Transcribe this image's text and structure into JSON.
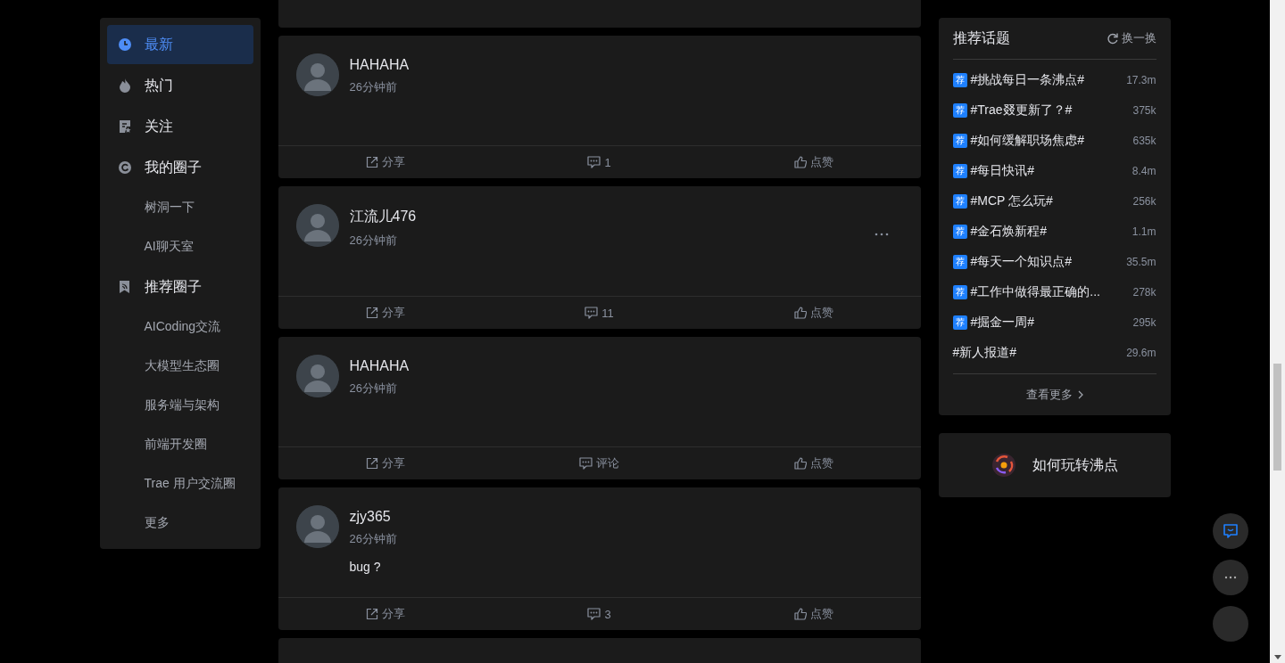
{
  "sidebar": {
    "items": [
      {
        "label": "最新",
        "kind": "latest",
        "selected": true
      },
      {
        "label": "热门",
        "kind": "hot",
        "selected": false
      },
      {
        "label": "关注",
        "kind": "follow",
        "selected": false
      },
      {
        "label": "我的圈子",
        "kind": "mine",
        "selected": false,
        "children": [
          {
            "label": "树洞一下",
            "selected": false
          },
          {
            "label": "AI聊天室",
            "selected": false
          }
        ]
      },
      {
        "label": "推荐圈子",
        "kind": "recommend",
        "selected": false,
        "children": [
          {
            "label": "AICoding交流",
            "selected": false
          },
          {
            "label": "大模型生态圈",
            "selected": false
          },
          {
            "label": "服务端与架构",
            "selected": false
          },
          {
            "label": "前端开发圈",
            "selected": false
          },
          {
            "label": "Trae 用户交流圈",
            "selected": false
          },
          {
            "label": "更多",
            "selected": false
          }
        ]
      }
    ]
  },
  "feed": {
    "posts": [
      {
        "author": "HAHAHA",
        "time": "26分钟前",
        "show_menu": false,
        "actions": {
          "share": "分享",
          "comment": "1",
          "like": "点赞"
        }
      },
      {
        "author": "江流儿476",
        "time": "26分钟前",
        "show_menu": true,
        "actions": {
          "share": "分享",
          "comment": "11",
          "like": "点赞"
        }
      },
      {
        "author": "HAHAHA",
        "time": "26分钟前",
        "show_menu": false,
        "actions": {
          "share": "分享",
          "comment": "评论",
          "like": "点赞"
        }
      },
      {
        "author": "zjy365",
        "time": "26分钟前",
        "content": "bug ?",
        "show_menu": false,
        "actions": {
          "share": "分享",
          "comment": "3",
          "like": "点赞"
        }
      }
    ]
  },
  "topics": {
    "title": "推荐话题",
    "refresh": "换一换",
    "items": [
      {
        "badge": "荐",
        "title": "#挑战每日一条沸点#",
        "count": "17.3m"
      },
      {
        "badge": "荐",
        "title": "#Trae叕更新了？#",
        "count": "375k"
      },
      {
        "badge": "荐",
        "title": "#如何缓解职场焦虑#",
        "count": "635k"
      },
      {
        "badge": "荐",
        "title": "#每日快讯#",
        "count": "8.4m"
      },
      {
        "badge": "荐",
        "title": "#MCP 怎么玩#",
        "count": "256k"
      },
      {
        "badge": "荐",
        "title": "#金石焕新程#",
        "count": "1.1m"
      },
      {
        "badge": "荐",
        "title": "#每天一个知识点#",
        "count": "35.5m"
      },
      {
        "badge": "荐",
        "title": "#工作中做得最正确的...",
        "count": "278k"
      },
      {
        "badge": "荐",
        "title": "#掘金一周#",
        "count": "295k"
      },
      {
        "title": "#新人报道#",
        "count": "29.6m"
      }
    ],
    "more": "查看更多"
  },
  "guide": {
    "title": "如何玩转沸点"
  }
}
